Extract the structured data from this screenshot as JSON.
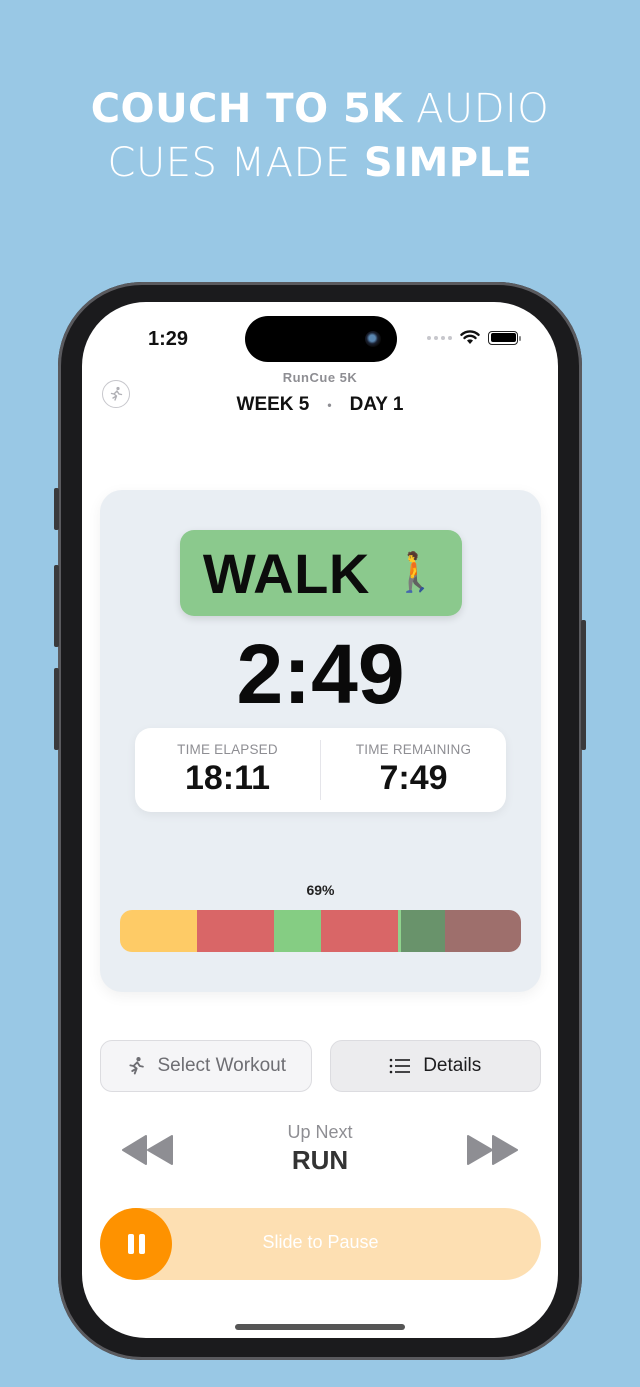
{
  "headline": {
    "line1_bold": "COUCH TO 5K",
    "line1_light": "AUDIO",
    "line2_light": "CUES MADE",
    "line2_bold": "SIMPLE"
  },
  "status_bar": {
    "time": "1:29",
    "signal_icon": "cellular-dots-icon",
    "wifi_icon": "wifi-icon",
    "battery_icon": "battery-full-icon"
  },
  "header": {
    "app_name": "RunCue 5K",
    "week": "WEEK 5",
    "separator": "•",
    "day": "DAY 1",
    "left_icon": "runner-circle-icon"
  },
  "current": {
    "phase": "WALK",
    "phase_emoji": "🚶",
    "phase_color": "#8bc98d",
    "countdown": "2:49"
  },
  "times": {
    "elapsed_label": "TIME ELAPSED",
    "elapsed": "18:11",
    "remaining_label": "TIME REMAINING",
    "remaining": "7:49"
  },
  "progress": {
    "percent_label": "69%",
    "percent": 69,
    "segments": [
      {
        "type": "warmup",
        "fraction": 0.192,
        "color": "#fecb66"
      },
      {
        "type": "run",
        "fraction": 0.192,
        "color": "#d96667"
      },
      {
        "type": "walk",
        "fraction": 0.117,
        "color": "#85cd83"
      },
      {
        "type": "run",
        "fraction": 0.192,
        "color": "#d96667"
      },
      {
        "type": "walk-done",
        "fraction": 0.008,
        "color": "#8fd38d"
      },
      {
        "type": "walk-remaining",
        "fraction": 0.11,
        "color": "#69936b"
      },
      {
        "type": "cooldown",
        "fraction": 0.189,
        "color": "#9e6f6c"
      }
    ]
  },
  "buttons": {
    "select_workout": "Select Workout",
    "details": "Details"
  },
  "up_next": {
    "label": "Up Next",
    "value": "RUN"
  },
  "slider": {
    "label": "Slide to Pause",
    "accent": "#fe9200"
  }
}
